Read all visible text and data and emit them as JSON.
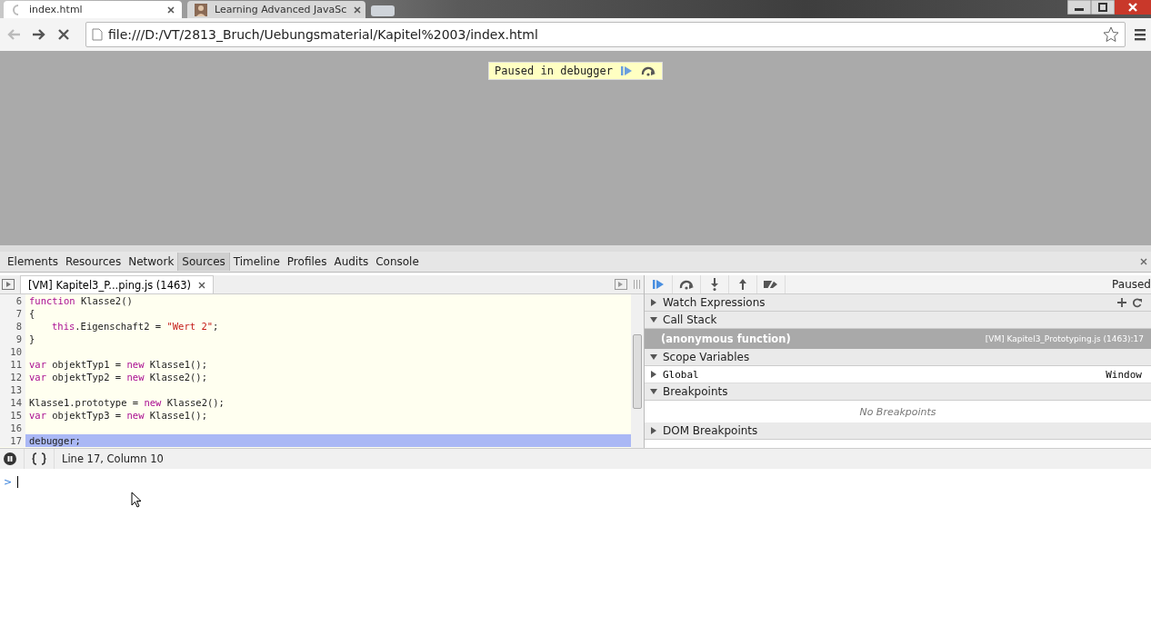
{
  "browser": {
    "tabs": [
      {
        "title": "index.html",
        "selected": true,
        "kind": "loading"
      },
      {
        "title": "Learning Advanced JavaSc",
        "selected": false,
        "kind": "site"
      }
    ],
    "address": "file:///D:/VT/2813_Bruch/Uebungsmaterial/Kapitel%2003/index.html"
  },
  "page": {
    "paused_banner": "Paused in debugger"
  },
  "devtools": {
    "tabs": [
      {
        "label": "Elements",
        "selected": false
      },
      {
        "label": "Resources",
        "selected": false
      },
      {
        "label": "Network",
        "selected": false
      },
      {
        "label": "Sources",
        "selected": true
      },
      {
        "label": "Timeline",
        "selected": false
      },
      {
        "label": "Profiles",
        "selected": false
      },
      {
        "label": "Audits",
        "selected": false
      },
      {
        "label": "Console",
        "selected": false
      }
    ],
    "file_tab": "[VM] Kapitel3_P...ping.js (1463)",
    "code": [
      {
        "number": "6",
        "highlighted": false,
        "tokens": [
          {
            "kind": "keyword",
            "text": "function"
          },
          {
            "kind": "plain",
            "text": " Klasse2()"
          }
        ]
      },
      {
        "number": "7",
        "highlighted": false,
        "tokens": [
          {
            "kind": "plain",
            "text": "{"
          }
        ]
      },
      {
        "number": "8",
        "highlighted": false,
        "indented": true,
        "tokens": [
          {
            "kind": "keyword",
            "text": "this"
          },
          {
            "kind": "plain",
            "text": ".Eigenschaft2 = "
          },
          {
            "kind": "string",
            "text": "\"Wert 2\""
          },
          {
            "kind": "plain",
            "text": ";"
          }
        ]
      },
      {
        "number": "9",
        "highlighted": false,
        "tokens": [
          {
            "kind": "plain",
            "text": "}"
          }
        ]
      },
      {
        "number": "10",
        "highlighted": false
      },
      {
        "number": "11",
        "highlighted": false,
        "tokens": [
          {
            "kind": "keyword",
            "text": "var"
          },
          {
            "kind": "plain",
            "text": " objektTyp1 = "
          },
          {
            "kind": "keyword",
            "text": "new"
          },
          {
            "kind": "plain",
            "text": " Klasse1();"
          }
        ]
      },
      {
        "number": "12",
        "highlighted": false,
        "tokens": [
          {
            "kind": "keyword",
            "text": "var"
          },
          {
            "kind": "plain",
            "text": " objektTyp2 = "
          },
          {
            "kind": "keyword",
            "text": "new"
          },
          {
            "kind": "plain",
            "text": " Klasse2();"
          }
        ]
      },
      {
        "number": "13",
        "highlighted": false
      },
      {
        "number": "14",
        "highlighted": false,
        "tokens": [
          {
            "kind": "plain",
            "text": "Klasse1.prototype = "
          },
          {
            "kind": "keyword",
            "text": "new"
          },
          {
            "kind": "plain",
            "text": " Klasse2();"
          }
        ]
      },
      {
        "number": "15",
        "highlighted": false,
        "tokens": [
          {
            "kind": "keyword",
            "text": "var"
          },
          {
            "kind": "plain",
            "text": " objektTyp3 = "
          },
          {
            "kind": "keyword",
            "text": "new"
          },
          {
            "kind": "plain",
            "text": " Klasse1();"
          }
        ]
      },
      {
        "number": "16",
        "highlighted": false
      },
      {
        "number": "17",
        "highlighted": true,
        "tokens": [
          {
            "kind": "plain",
            "text": "debugger;"
          }
        ]
      }
    ],
    "status": "Line 17, Column 10",
    "paused_label": "Paused",
    "sidebar": [
      {
        "title": "Watch Expressions",
        "expanded": false,
        "actions": true
      },
      {
        "title": "Call Stack",
        "expanded": true,
        "frames": [
          {
            "name": "(anonymous function)",
            "location": "[VM] Kapitel3_Prototyping.js (1463):17",
            "selected": true
          }
        ]
      },
      {
        "title": "Scope Variables",
        "expanded": true,
        "scopes": [
          {
            "name": "Global",
            "value": "Window",
            "expanded": false
          }
        ]
      },
      {
        "title": "Breakpoints",
        "expanded": true,
        "empty": "No Breakpoints"
      },
      {
        "title": "DOM Breakpoints",
        "expanded": false
      }
    ]
  },
  "console": {
    "prompt": ">"
  }
}
